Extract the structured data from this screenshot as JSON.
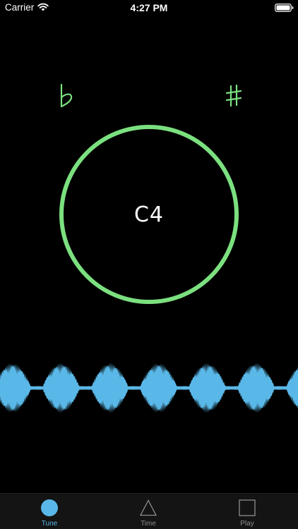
{
  "status_bar": {
    "carrier": "Carrier",
    "time": "4:27 PM",
    "wifi_icon": "wifi-icon",
    "battery_icon": "battery-full-icon"
  },
  "tuner": {
    "flat_symbol": "♭",
    "sharp_symbol": "♯",
    "note": "C4",
    "ring_color": "#7be07f",
    "waveform_color": "#5ab8e8"
  },
  "tab_bar": {
    "selected": "Tune",
    "active_color": "#5ab8e8",
    "inactive_color": "#8e8e93",
    "tabs": [
      {
        "label": "Tune",
        "icon": "circle-icon"
      },
      {
        "label": "Time",
        "icon": "triangle-icon"
      },
      {
        "label": "Play",
        "icon": "square-icon"
      }
    ]
  }
}
